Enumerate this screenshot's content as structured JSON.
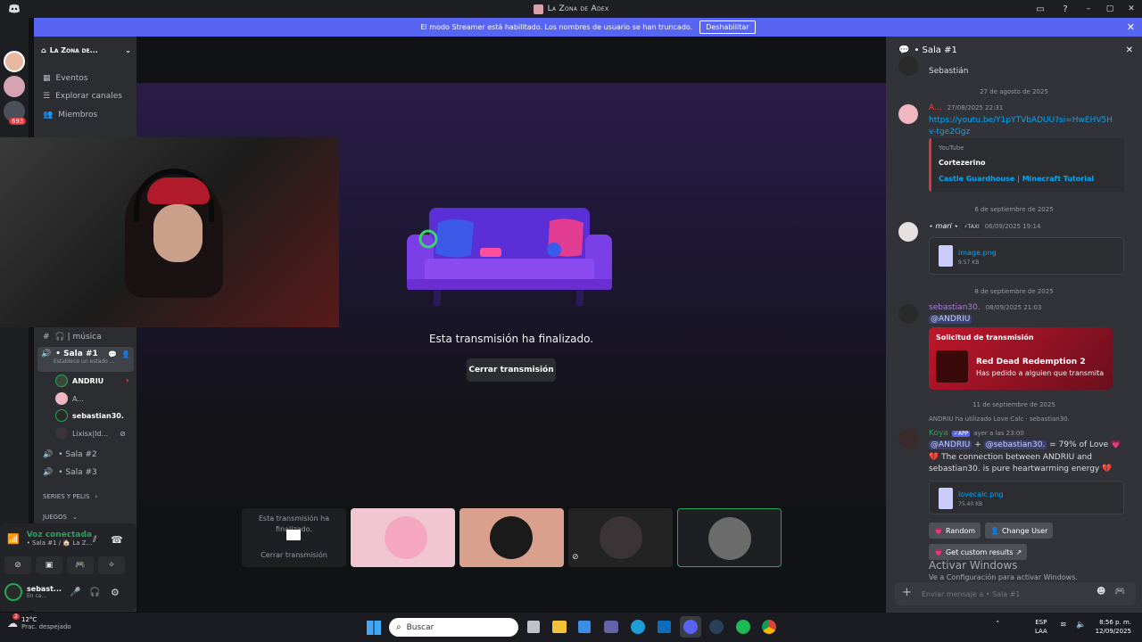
{
  "titlebar": {
    "title": "La Zona de Adex"
  },
  "banner": {
    "text": "El modo Streamer está habilitado. Los nombres de usuario se han truncado.",
    "button": "Deshabilitar"
  },
  "rail": {
    "badge": "693"
  },
  "server": {
    "name": "La Zona de...",
    "nav": [
      "Eventos",
      "Explorar canales",
      "Miembros"
    ]
  },
  "channels": {
    "musica": "🎧 | música",
    "sala1": "• Sala #1",
    "sala1_status": "Establece un estado ...",
    "members": [
      "ANDRIU",
      "A...",
      "sebastian30.",
      "Lixisx|ld..."
    ],
    "sala2": "• Sala #2",
    "sala3": "• Sala #3",
    "series": "SERIES Y PELIS",
    "juegos": "JUEGOS"
  },
  "voice": {
    "status": "Voz conectada",
    "location": "• Sala #1 / 🏠 La Z..."
  },
  "user": {
    "name": "sebast...",
    "status": "En ca..."
  },
  "stage": {
    "ended_text": "Esta transmisión ha finalizado.",
    "close_button": "Cerrar transmisión"
  },
  "tiles": {
    "ended_text": "Esta transmisión ha finalizado.",
    "close_button": "Cerrar transmisión"
  },
  "chat": {
    "header": "• Sala #1",
    "prev_author": "Sebastián",
    "date1": "27 de agosto de 2025",
    "msg1": {
      "author": "A...",
      "time": "27/08/2025 22:31",
      "link": "https://youtu.be/Y1pYTVbADUU?si=HwEHV5Hv-tge2Ggz",
      "embed_provider": "YouTube",
      "embed_author": "Cortezerino",
      "embed_title": "Castle Guardhouse | Minecraft Tutorial"
    },
    "date2": "6 de septiembre de 2025",
    "msg2": {
      "author": "⋆ mari ⋆",
      "tag": "⚡TAXI",
      "time": "06/09/2025 19:14",
      "file": "image.png",
      "size": "9.57 KB"
    },
    "date3": "8 de septiembre de 2025",
    "msg3": {
      "author": "sebastian30.",
      "time": "08/09/2025 21:03",
      "mention": "@ANDRIU",
      "card_title": "Solicitud de transmisión",
      "game": "Red Dead Redemption 2",
      "game_sub": "Has pedido a alguien que transmita"
    },
    "date4": "11 de septiembre de 2025",
    "msg4": {
      "reply": "ANDRIU ha utilizado Love Calc · sebastian30.",
      "author": "Koya",
      "app": "✓APP",
      "time": "ayer a las 23:00",
      "line1a": "@ANDRIU",
      "line1b": " + ",
      "line1c": "@sebastian30.",
      "line1d": " = 79% of Love 💗",
      "line2": "💔 The connection between ANDRIU and sebastian30. is pure heartwarming energy 💔",
      "file": "lovecalc.png",
      "size": "75.40 KB",
      "btn_random": "Random",
      "btn_change": "Change User",
      "btn_results": "Get custom results"
    },
    "watermark1": "Activar Windows",
    "watermark2": "Ve a Configuración para activar Windows.",
    "input_placeholder": "Enviar mensaje a • Sala #1"
  },
  "taskbar": {
    "weather_temp": "12°C",
    "weather_desc": "Prac. despejado",
    "weather_badge": "2",
    "search": "Buscar",
    "lang1": "ESP",
    "lang2": "LAA",
    "time": "8:56 p. m.",
    "date": "12/09/2025"
  },
  "colors": {
    "brand": "#5865f2",
    "accent": "#7b3fe4",
    "green": "#23a55a",
    "red": "#da373c"
  }
}
